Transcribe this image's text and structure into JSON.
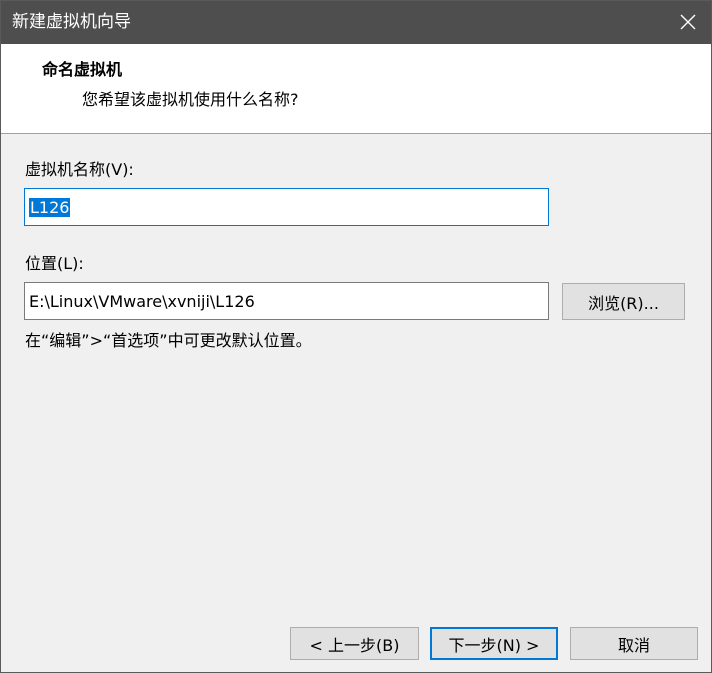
{
  "window": {
    "title": "新建虚拟机向导",
    "close_icon": "close-icon"
  },
  "header": {
    "title": "命名虚拟机",
    "subtitle": "您希望该虚拟机使用什么名称?"
  },
  "form": {
    "name_label": "虚拟机名称(V):",
    "name_value": "L126",
    "location_label": "位置(L):",
    "location_value": "E:\\Linux\\VMware\\xvniji\\L126",
    "browse_label": "浏览(R)...",
    "hint": "在“编辑”>“首选项”中可更改默认位置。"
  },
  "footer": {
    "back_label": "< 上一步(B)",
    "next_label": "下一步(N) >",
    "cancel_label": "取消"
  },
  "colors": {
    "titlebar": "#4e4e4e",
    "accent": "#0078d7",
    "dialog_bg": "#f0f0f0"
  }
}
